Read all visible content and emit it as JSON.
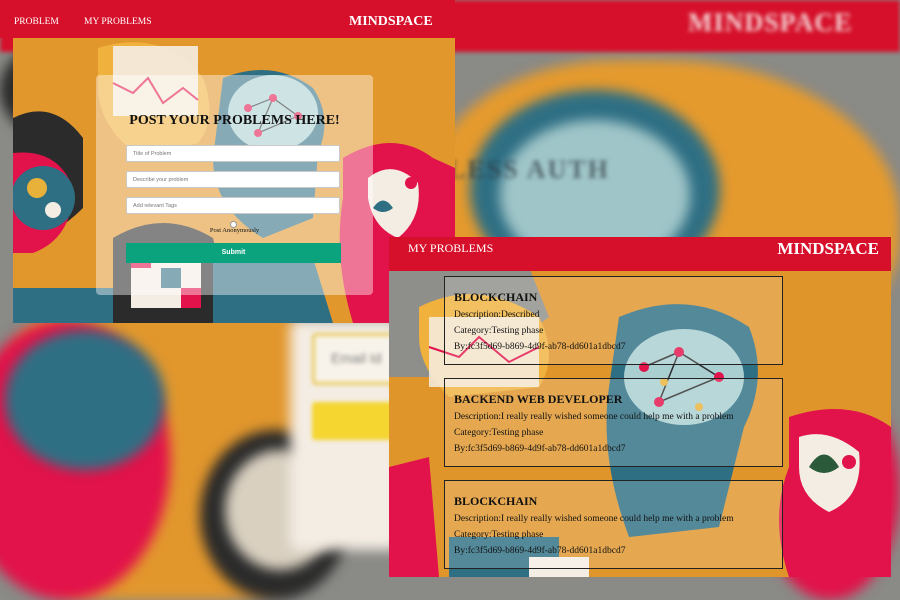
{
  "background": {
    "brand": "MINDSPACE",
    "overlay_text": "LESS AUTH",
    "email_placeholder": "Email Id"
  },
  "window1": {
    "nav": {
      "problem_link": "PROBLEM",
      "my_problems_link": "MY PROBLEMS",
      "brand": "MINDSPACE"
    },
    "form": {
      "heading": "POST YOUR PROBLEMS HERE!",
      "title_placeholder": "Title of Problem",
      "description_placeholder": "Describe your problem",
      "tags_placeholder": "Add relevant Tags",
      "anonymous_label": "Post Anonymously",
      "submit_label": "Submit"
    }
  },
  "window2": {
    "nav": {
      "my_problems_link": "MY PROBLEMS",
      "brand": "MINDSPACE"
    },
    "problems": [
      {
        "title": "BLOCKCHAIN",
        "description": "Description:Described",
        "category": "Category:Testing phase",
        "by": "By:fc3f5d69-b869-4d9f-ab78-dd601a1dbcd7"
      },
      {
        "title": "BACKEND WEB DEVELOPER",
        "description": "Description:I really really wished someone could help me with a problem",
        "category": "Category:Testing phase",
        "by": "By:fc3f5d69-b869-4d9f-ab78-dd601a1dbcd7"
      },
      {
        "title": "BLOCKCHAIN",
        "description": "Description:I really really wished someone could help me with a problem",
        "category": "Category:Testing phase",
        "by": "By:fc3f5d69-b869-4d9f-ab78-dd601a1dbcd7"
      }
    ]
  },
  "colors": {
    "brand_red": "#d6102a",
    "submit_green": "#0ba37d",
    "art_orange": "#e2972d",
    "art_teal": "#2f6f84",
    "art_pink": "#e2124a"
  }
}
